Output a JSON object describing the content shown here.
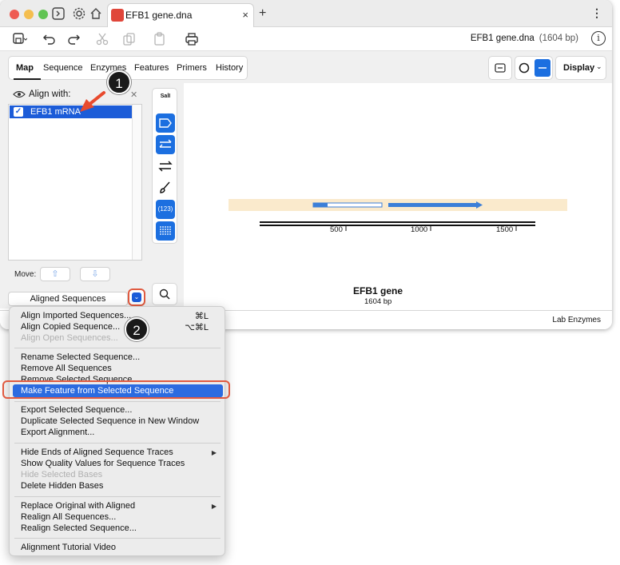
{
  "tab": {
    "title": "EFB1 gene.dna",
    "close": "×",
    "new_tab": "+"
  },
  "toolbar": {
    "filename": "EFB1 gene.dna",
    "length": "(1604 bp)",
    "info": "i"
  },
  "view_tabs": [
    {
      "label": "Map"
    },
    {
      "label": "Sequence"
    },
    {
      "label": "Enzymes"
    },
    {
      "label": "Features"
    },
    {
      "label": "Primers"
    },
    {
      "label": "History"
    }
  ],
  "display": {
    "label": "Display"
  },
  "align_panel": {
    "align_with": "Align with:",
    "item": "EFB1 mRNA",
    "item_checked": "✓",
    "move": "Move:",
    "aligned_sequences": "Aligned Sequences"
  },
  "side_tools": {
    "sall": "SalI",
    "orf": "(123)"
  },
  "map": {
    "title": "EFB1 gene",
    "length": "1604 bp",
    "ticks": [
      "500",
      "1000",
      "1500"
    ]
  },
  "status": {
    "lab_enzymes": "Lab Enzymes"
  },
  "menu": {
    "group1": [
      {
        "label": "Align Imported Sequences...",
        "shortcut": "⌘L",
        "disabled": false
      },
      {
        "label": "Align Copied Sequence...",
        "shortcut": "⌥⌘L",
        "disabled": false
      },
      {
        "label": "Align Open Sequences...",
        "shortcut": "",
        "disabled": true
      }
    ],
    "group2": [
      {
        "label": "Rename Selected Sequence...",
        "disabled": false
      },
      {
        "label": "Remove All Sequences",
        "disabled": false
      },
      {
        "label": "Remove Selected Sequence",
        "disabled": false
      },
      {
        "label": "Make Feature from Selected Sequence",
        "disabled": false,
        "highlighted": true
      }
    ],
    "group3": [
      {
        "label": "Export Selected Sequence...",
        "disabled": false
      },
      {
        "label": "Duplicate Selected Sequence in New Window",
        "disabled": false
      },
      {
        "label": "Export Alignment...",
        "disabled": false
      }
    ],
    "group4": [
      {
        "label": "Hide Ends of Aligned Sequence Traces",
        "submenu": true,
        "disabled": false
      },
      {
        "label": "Show Quality Values for Sequence Traces",
        "disabled": false
      },
      {
        "label": "Hide Selected Bases",
        "disabled": true
      },
      {
        "label": "Delete Hidden Bases",
        "disabled": false
      }
    ],
    "group5": [
      {
        "label": "Replace Original with Aligned",
        "submenu": true,
        "disabled": false
      },
      {
        "label": "Realign All Sequences...",
        "disabled": false
      },
      {
        "label": "Realign Selected Sequence...",
        "disabled": false
      }
    ],
    "group6": [
      {
        "label": "Alignment Tutorial Video",
        "disabled": false
      }
    ]
  },
  "callouts": [
    "1",
    "2"
  ],
  "colors": {
    "accent_blue": "#1c6fe0",
    "highlight_red": "#e05a40",
    "feature_band": "#faeacc"
  }
}
